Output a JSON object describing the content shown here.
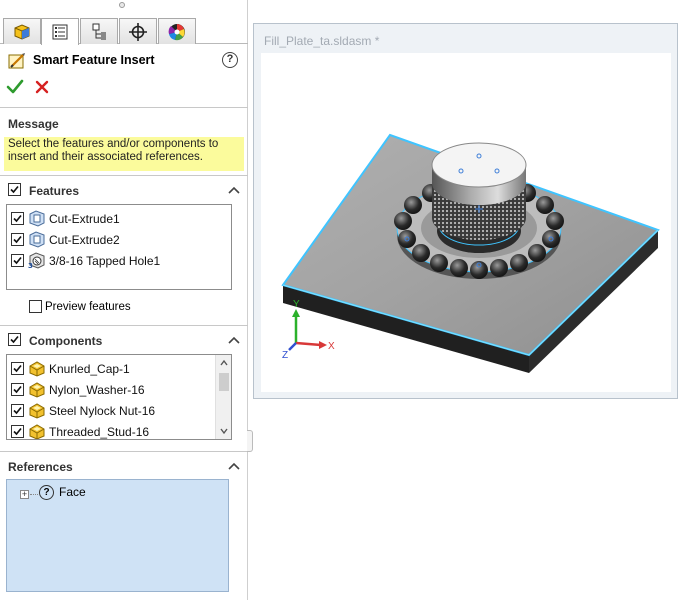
{
  "property_manager": {
    "tabs": [
      {
        "icon": "feature-manager-icon",
        "active": false
      },
      {
        "icon": "property-manager-icon",
        "active": true
      },
      {
        "icon": "configuration-manager-icon",
        "active": false
      },
      {
        "icon": "dimxpert-manager-icon",
        "active": false
      },
      {
        "icon": "display-manager-icon",
        "active": false
      }
    ],
    "title": "Smart Feature Insert",
    "accent_colors": {
      "ok": "#2e9b2e",
      "cancel": "#d62020",
      "message_bg": "#fbfb9c",
      "selection_blue": "#cfe2f5",
      "highlight_cyan": "#3fc4ff"
    },
    "message": {
      "heading": "Message",
      "text": "Select the features and/or components to insert and their associated references."
    },
    "features": {
      "heading": "Features",
      "checked": true,
      "items": [
        {
          "label": "Cut-Extrude1",
          "checked": true,
          "icon": "cut-extrude-icon"
        },
        {
          "label": "Cut-Extrude2",
          "checked": true,
          "icon": "cut-extrude-icon"
        },
        {
          "label": "3/8-16 Tapped Hole1",
          "checked": true,
          "icon": "tapped-hole-icon"
        }
      ],
      "preview_label": "Preview features",
      "preview_checked": false
    },
    "components": {
      "heading": "Components",
      "checked": true,
      "items": [
        {
          "label": "Knurled_Cap-1",
          "checked": true,
          "icon": "part-icon"
        },
        {
          "label": "Nylon_Washer-16",
          "checked": true,
          "icon": "part-icon"
        },
        {
          "label": "Steel Nylock Nut-16",
          "checked": true,
          "icon": "part-icon"
        },
        {
          "label": "Threaded_Stud-16",
          "checked": true,
          "icon": "part-icon"
        }
      ]
    },
    "references": {
      "heading": "References",
      "items": [
        {
          "label": "Face",
          "icon": "unresolved-question-icon"
        }
      ]
    }
  },
  "viewport": {
    "document_title": "Fill_Plate_ta.sldasm *",
    "triad": {
      "x": "X",
      "y": "Y",
      "z": "Z"
    }
  }
}
